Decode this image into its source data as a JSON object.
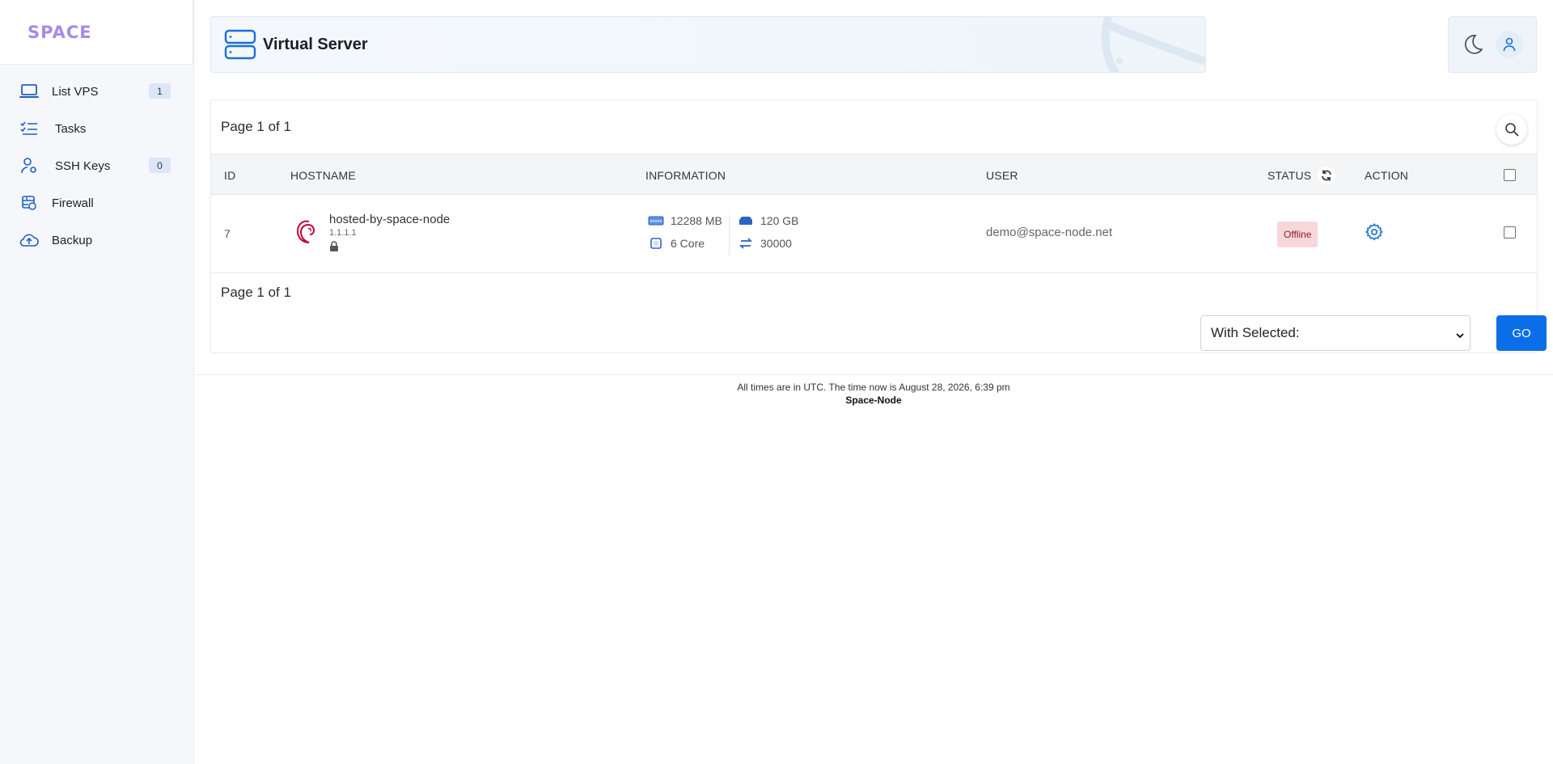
{
  "brand": {
    "name": "SPACE"
  },
  "sidebar": {
    "items": [
      {
        "label": "List VPS",
        "badge": "1",
        "icon": "laptop-icon"
      },
      {
        "label": "Tasks",
        "icon": "tasks-icon"
      },
      {
        "label": "SSH Keys",
        "badge": "0",
        "icon": "user-key-icon"
      },
      {
        "label": "Firewall",
        "icon": "firewall-icon"
      },
      {
        "label": "Backup",
        "icon": "cloud-upload-icon"
      }
    ]
  },
  "header": {
    "title": "Virtual Server",
    "icon": "server-icon"
  },
  "top_actions": {
    "theme_icon": "moon-icon",
    "user_icon": "user-icon"
  },
  "table": {
    "page_info_top": "Page 1 of 1",
    "page_info_bottom": "Page 1 of 1",
    "columns": [
      "ID",
      "HOSTNAME",
      "INFORMATION",
      "USER",
      "STATUS",
      "ACTION"
    ],
    "rows": [
      {
        "id": "7",
        "hostname": "hosted-by-space-node",
        "ip": "1.1.1.1",
        "ram": "12288 MB",
        "cpu": "6 Core",
        "disk": "120 GB",
        "bandwidth": "30000",
        "user": "demo@space-node.net",
        "status": "Offline"
      }
    ]
  },
  "bulk": {
    "selected": "With Selected:",
    "go_label": "GO"
  },
  "footer": {
    "time_text": "All times are in UTC. The time now is August 28, 2026, 6:39 pm",
    "company": "Space-Node"
  },
  "colors": {
    "accent": "#0a6ee8",
    "brand": "#a58be6",
    "offline_bg": "#f8d7da",
    "offline_text": "#8b1e27"
  }
}
